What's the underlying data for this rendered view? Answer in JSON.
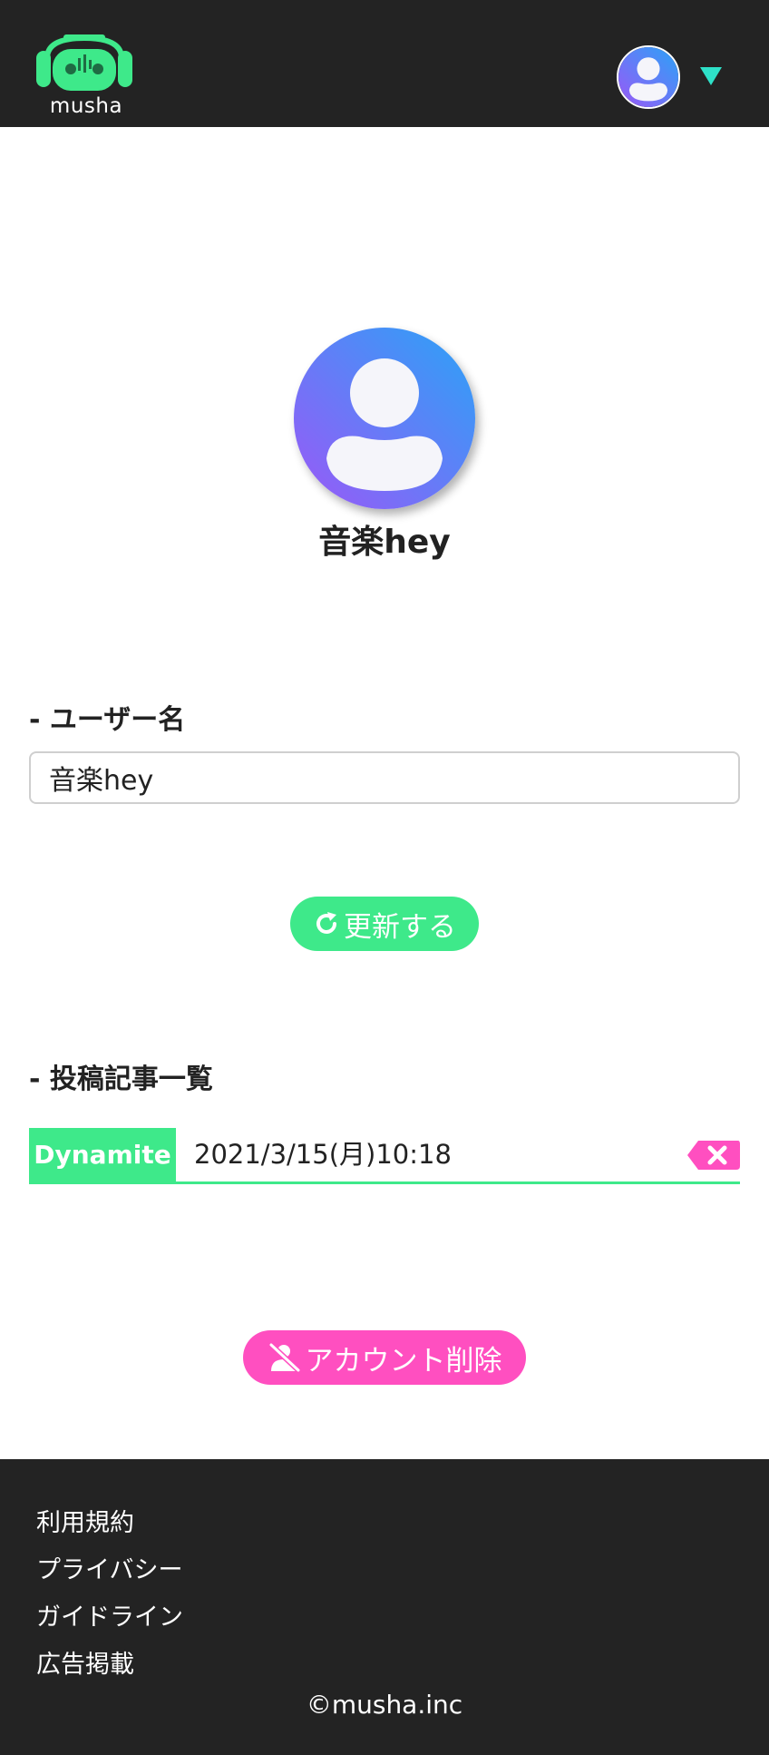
{
  "header": {
    "logo_text": "musha",
    "colors": {
      "background": "#232323",
      "accent": "#3ee98a",
      "caret": "#2ee0c8"
    }
  },
  "profile": {
    "name": "音楽hey",
    "avatar_gradient": [
      "#2aa3f7",
      "#9b58f7"
    ]
  },
  "username_section": {
    "label": "- ユーザー名",
    "input_value": "音楽hey"
  },
  "update_button": {
    "label": "更新する",
    "icon": "refresh-icon",
    "color": "#3ee98a"
  },
  "posts_section": {
    "label": "- 投稿記事一覧",
    "items": [
      {
        "tag": "Dynamite",
        "date": "2021/3/15(月)10:18",
        "delete_icon": "backspace-x-icon"
      }
    ]
  },
  "delete_account_button": {
    "label": "アカウント削除",
    "icon": "user-slash-icon",
    "color": "#ff4fc0"
  },
  "footer": {
    "links": [
      "利用規約",
      "プライバシー",
      "ガイドライン",
      "広告掲載"
    ],
    "copyright": "©musha.inc"
  }
}
